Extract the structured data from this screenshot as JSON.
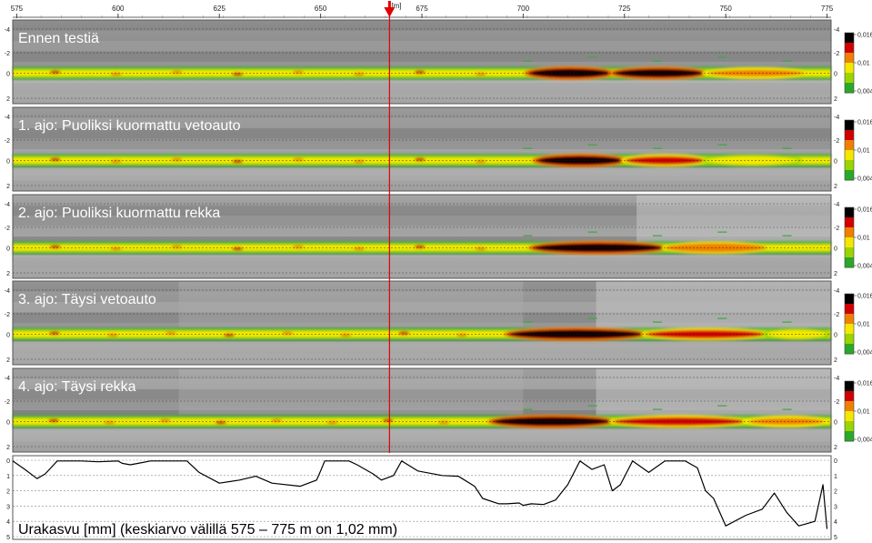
{
  "chart_data": {
    "type": "heatmap",
    "x_axis": {
      "unit": "[m]",
      "ticks": [
        575,
        600,
        625,
        650,
        675,
        700,
        725,
        750,
        775
      ],
      "range": [
        574,
        776
      ]
    },
    "marker": {
      "position_m": 667,
      "color": "#e00000"
    },
    "colorbar": {
      "ticks": [
        "0,016",
        "0,01",
        "0,004"
      ],
      "colors": [
        "#000000",
        "#d10000",
        "#f08000",
        "#f5e800",
        "#9bd400",
        "#2aa82a"
      ]
    },
    "panels": [
      {
        "title": "Ennen testiä",
        "y_ticks": [
          "-4",
          "-2",
          "0",
          "2"
        ],
        "hotspots": [
          {
            "from": 701,
            "to": 722,
            "peak": 1.0
          },
          {
            "from": 722,
            "to": 745,
            "peak": 0.85
          },
          {
            "from": 745,
            "to": 770,
            "peak": 0.5
          },
          {
            "from": 580,
            "to": 700,
            "peak": 0.25
          }
        ],
        "green_tail_from": 690
      },
      {
        "title": "1. ajo: Puoliksi kuormattu vetoauto",
        "y_ticks": [
          "-4",
          "-2",
          "0",
          "2"
        ],
        "hotspots": [
          {
            "from": 703,
            "to": 725,
            "peak": 1.0
          },
          {
            "from": 725,
            "to": 745,
            "peak": 0.7
          },
          {
            "from": 745,
            "to": 768,
            "peak": 0.45
          },
          {
            "from": 580,
            "to": 700,
            "peak": 0.3
          }
        ],
        "green_tail_from": 690
      },
      {
        "title": "2. ajo: Puoliksi kuormattu rekka",
        "y_ticks": [
          "-4",
          "-2",
          "0",
          "2"
        ],
        "hotspots": [
          {
            "from": 702,
            "to": 735,
            "peak": 1.0
          },
          {
            "from": 735,
            "to": 760,
            "peak": 0.6
          },
          {
            "from": 580,
            "to": 700,
            "peak": 0.3
          }
        ],
        "green_tail_from": 690
      },
      {
        "title": "3. ajo: Täysi vetoauto",
        "y_ticks": [
          "-4",
          "-2",
          "0",
          "2"
        ],
        "hotspots": [
          {
            "from": 696,
            "to": 730,
            "peak": 1.0
          },
          {
            "from": 730,
            "to": 760,
            "peak": 0.7
          },
          {
            "from": 760,
            "to": 775,
            "peak": 0.45
          },
          {
            "from": 580,
            "to": 695,
            "peak": 0.35
          }
        ],
        "green_tail_from": 690
      },
      {
        "title": "4. ajo: Täysi rekka",
        "y_ticks": [
          "-4",
          "-2",
          "0",
          "2"
        ],
        "hotspots": [
          {
            "from": 692,
            "to": 722,
            "peak": 1.0
          },
          {
            "from": 722,
            "to": 755,
            "peak": 0.75
          },
          {
            "from": 755,
            "to": 775,
            "peak": 0.5
          },
          {
            "from": 580,
            "to": 690,
            "peak": 0.35
          }
        ],
        "green_tail_from": 690
      }
    ],
    "profile": {
      "title": "Urakasvu [mm] (keskiarvo välillä 575 – 775 m on 1,02 mm)",
      "y_ticks": [
        "0",
        "1",
        "2",
        "3",
        "4",
        "5"
      ],
      "ylim": [
        0,
        5
      ],
      "x": [
        574,
        577,
        580,
        582,
        585,
        590,
        591,
        595,
        600,
        601,
        603,
        605,
        608,
        613,
        617,
        620,
        625,
        630,
        634,
        638,
        645,
        649,
        650,
        651,
        657,
        659,
        663,
        665,
        668,
        670,
        674,
        680,
        684,
        688,
        690,
        694,
        696,
        699,
        700,
        702,
        705,
        708,
        711,
        714,
        717,
        720,
        722,
        724,
        727,
        731,
        735,
        738,
        740,
        743,
        745,
        747,
        750,
        755,
        759,
        762,
        765,
        768,
        772,
        774,
        775
      ],
      "y": [
        0.05,
        0.6,
        1.2,
        0.9,
        0.05,
        0.05,
        0.05,
        0.1,
        0.05,
        0.2,
        0.3,
        0.2,
        0.05,
        0.05,
        0.05,
        0.8,
        1.5,
        1.3,
        1.05,
        1.5,
        1.7,
        1.3,
        0.7,
        0.05,
        0.05,
        0.3,
        0.9,
        1.3,
        1.0,
        0.05,
        0.7,
        1.0,
        1.05,
        1.7,
        2.5,
        2.85,
        2.85,
        2.8,
        2.95,
        2.85,
        2.9,
        2.6,
        1.6,
        0.05,
        0.6,
        0.3,
        2.0,
        1.6,
        0.05,
        0.8,
        0.05,
        0.05,
        0.05,
        0.5,
        2.0,
        2.5,
        4.3,
        3.6,
        3.2,
        2.15,
        3.4,
        4.3,
        4.0,
        1.6,
        4.5
      ]
    }
  }
}
